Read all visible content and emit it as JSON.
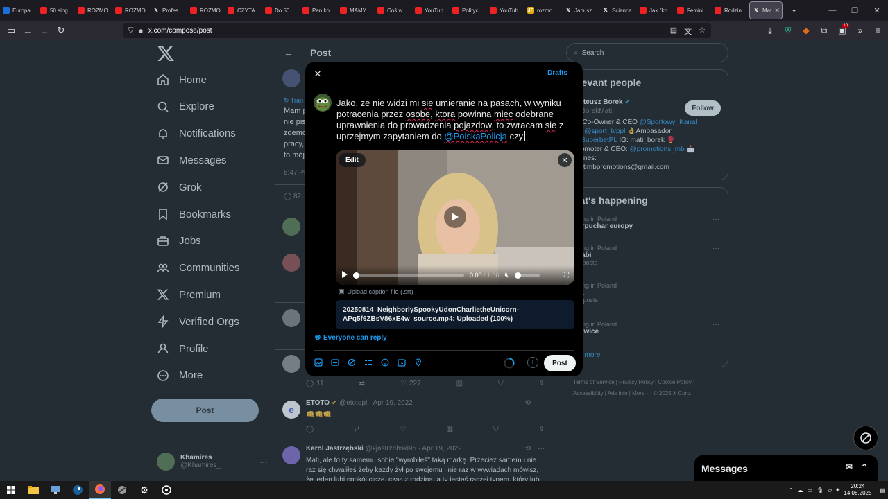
{
  "browser": {
    "tabs": [
      {
        "label": "Europa",
        "color": "#1d6fd8",
        "glyph": ""
      },
      {
        "label": "50 sing",
        "color": "#e22",
        "glyph": ""
      },
      {
        "label": "ROZMO",
        "color": "#e22",
        "glyph": ""
      },
      {
        "label": "ROZMO",
        "color": "#e22",
        "glyph": ""
      },
      {
        "label": "Profes",
        "color": "#1c1b22",
        "glyph": "𝕏"
      },
      {
        "label": "ROZMO",
        "color": "#e22",
        "glyph": ""
      },
      {
        "label": "CZYTA",
        "color": "#e22",
        "glyph": ""
      },
      {
        "label": "Do 50",
        "color": "#e22",
        "glyph": ""
      },
      {
        "label": "Pan ko",
        "color": "#e22",
        "glyph": ""
      },
      {
        "label": "MAMY",
        "color": "#e22",
        "glyph": ""
      },
      {
        "label": "Coś w",
        "color": "#e22",
        "glyph": ""
      },
      {
        "label": "YouTub",
        "color": "#e22",
        "glyph": ""
      },
      {
        "label": "Polityc",
        "color": "#e22",
        "glyph": ""
      },
      {
        "label": "YouTub",
        "color": "#e22",
        "glyph": ""
      },
      {
        "label": "rozmo",
        "color": "#e0a800",
        "glyph": "JP"
      },
      {
        "label": "Janusz",
        "color": "#1c1b22",
        "glyph": "𝕏"
      },
      {
        "label": "Science",
        "color": "#1c1b22",
        "glyph": "𝕏"
      },
      {
        "label": "Jak \"ko",
        "color": "#e22",
        "glyph": ""
      },
      {
        "label": "Femini",
        "color": "#e22",
        "glyph": ""
      },
      {
        "label": "Rodzin",
        "color": "#e22",
        "glyph": ""
      }
    ],
    "active_tab": {
      "label": "Mat",
      "glyph": "𝕏"
    },
    "url": "x.com/compose/post",
    "ext_badge": "10"
  },
  "sidebar": {
    "items": [
      {
        "label": "Home",
        "icon": "home-icon"
      },
      {
        "label": "Explore",
        "icon": "search-icon"
      },
      {
        "label": "Notifications",
        "icon": "bell-icon"
      },
      {
        "label": "Messages",
        "icon": "mail-icon"
      },
      {
        "label": "Grok",
        "icon": "grok-icon"
      },
      {
        "label": "Bookmarks",
        "icon": "bookmark-icon"
      },
      {
        "label": "Jobs",
        "icon": "briefcase-icon"
      },
      {
        "label": "Communities",
        "icon": "people-icon"
      },
      {
        "label": "Premium",
        "icon": "x-icon"
      },
      {
        "label": "Verified Orgs",
        "icon": "lightning-icon"
      },
      {
        "label": "Profile",
        "icon": "person-icon"
      },
      {
        "label": "More",
        "icon": "more-circle-icon"
      }
    ],
    "post_label": "Post",
    "user": {
      "name": "Khamires",
      "handle": "@Khamires_"
    }
  },
  "timeline": {
    "title": "Post",
    "fragments": {
      "trans": "Tran",
      "line1": "Mam p",
      "line2": "nie pis",
      "line3": "zdemo",
      "line4": "pracy,",
      "line5": "to mój",
      "time": "6:47 PM",
      "count": "82"
    },
    "row_counts": {
      "replies": "11",
      "likes": "227"
    },
    "tweets": [
      {
        "name": "ETOTO",
        "handle": "@etotopl",
        "date": "· Apr 19, 2022",
        "body": "👊👊👊"
      },
      {
        "name": "Karol Jastrzębski",
        "handle": "@kjastrzebski95",
        "date": "· Apr 19, 2022",
        "body": "Mati, ale to ty samemu sobie \"wyrobiłeś\" taką markę. Przecież samemu nie raz się chwaliłeś żeby każdy żył po swojemu i nie raz w wywiadach mówisz, że jeden lubi spokój ciszę, czas z rodziną, a ty jesteś raczej typem, który lubi"
      }
    ]
  },
  "right": {
    "search_placeholder": "Search",
    "relevant_title": "elevant people",
    "person": {
      "name": "Mateusz Borek",
      "handle": "@BorekMati",
      "follow": "Follow",
      "bio_1a": "😎Co-Owner & CEO ",
      "bio_1b": "@Sportowy_Kanal",
      "bio_2a": "🎙️",
      "bio_2b": "@sport_tvppl",
      "bio_2c": " 👌Ambasador",
      "bio_3a": "@SuperbetPL",
      "bio_3b": " IG: mati_borek 🥊",
      "bio_4a": "Promoter & CEO: ",
      "bio_4b": "@promotions_mb",
      "bio_4c": " 📩",
      "bio_5": "Biznes:",
      "bio_6": "matimbpromotions@gmail.com"
    },
    "happening_title": "hat's happening",
    "trends": [
      {
        "ctx": "nding in Poland",
        "title": "perpuchar europy",
        "count": ""
      },
      {
        "ctx": "nding in Poland",
        "title": "ccabi",
        "count": "84 posts"
      },
      {
        "ctx": "nding in Poland",
        "title": "nia",
        "count": "6K posts"
      },
      {
        "ctx": "nding in Poland",
        "title": "ólewice",
        "count": ""
      }
    ],
    "show_more": "ow more",
    "footer": {
      "terms": "Terms of Service",
      "privacy": "Privacy Policy",
      "cookie": "Cookie Policy",
      "access": "Accessibility",
      "ads": "Ads info",
      "more": "More ···",
      "copy": "© 2025 X Corp."
    },
    "messages_title": "Messages"
  },
  "compose": {
    "drafts": "Drafts",
    "text_parts": {
      "p1": "Jako, ze nie widzi mi ",
      "w1": "sie",
      "p2": " umieranie na pasach, w wyniku potracenia przez ",
      "w2": "osobe",
      "p3": ", ",
      "w3": "ktora",
      "p4": " powinna ",
      "w4": "miec",
      "p5": " odebrane uprawnienia do prowadzenia ",
      "w5": "pojazdow",
      "p6": ", to zwracam ",
      "w6": "sie",
      "p7": " z uprzejmym zapytaniem do ",
      "mention": "@PolskaPolicja",
      "p8": " czy"
    },
    "video": {
      "edit": "Edit",
      "time_current": "0:00",
      "time_sep": " / ",
      "time_total": "1:00"
    },
    "caption_label": "Upload caption file (.srt)",
    "upload_line1": "20250814_NeighborlySpookyUdonCharlietheUnicorn-",
    "upload_line2": "APq5f6ZBsV86xE4w_source.mp4: Uploaded (100%)",
    "reply_setting": "Everyone can reply",
    "post_button": "Post"
  },
  "taskbar": {
    "time": "20:24",
    "date": "14.08.2025"
  }
}
